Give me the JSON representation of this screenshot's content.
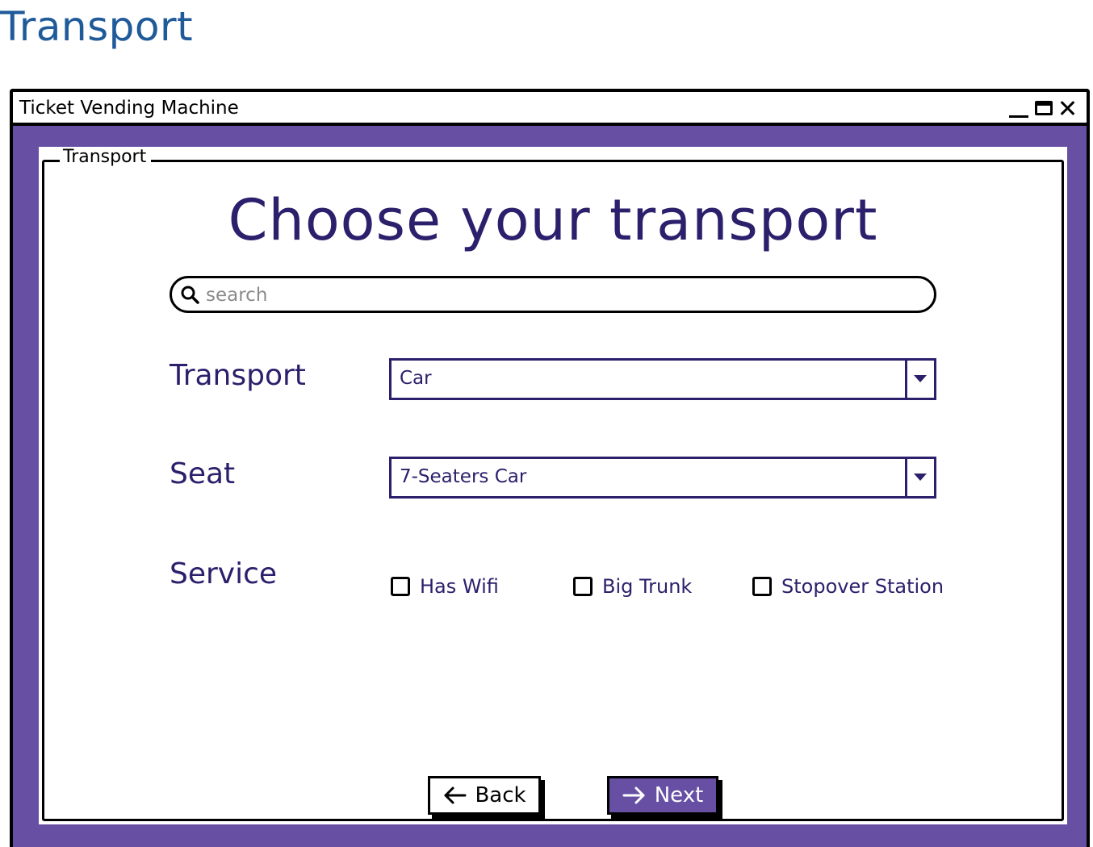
{
  "page": {
    "title": "Transport"
  },
  "window": {
    "title": "Ticket Vending Machine"
  },
  "group": {
    "legend": "Transport"
  },
  "main": {
    "heading": "Choose your transport"
  },
  "search": {
    "placeholder": "search",
    "value": ""
  },
  "form": {
    "transport_label": "Transport",
    "transport_value": "Car",
    "seat_label": "Seat",
    "seat_value": "7-Seaters Car",
    "service_label": "Service",
    "services": [
      {
        "label": "Has Wifi",
        "checked": false
      },
      {
        "label": "Big Trunk",
        "checked": false
      },
      {
        "label": "Stopover Station",
        "checked": false
      }
    ]
  },
  "actions": {
    "back_label": "Back",
    "next_label": "Next"
  },
  "colors": {
    "frame": "#6750a4",
    "heading": "#2c1f6b",
    "page_title": "#1f5a99",
    "next_button": "#6750a4"
  }
}
